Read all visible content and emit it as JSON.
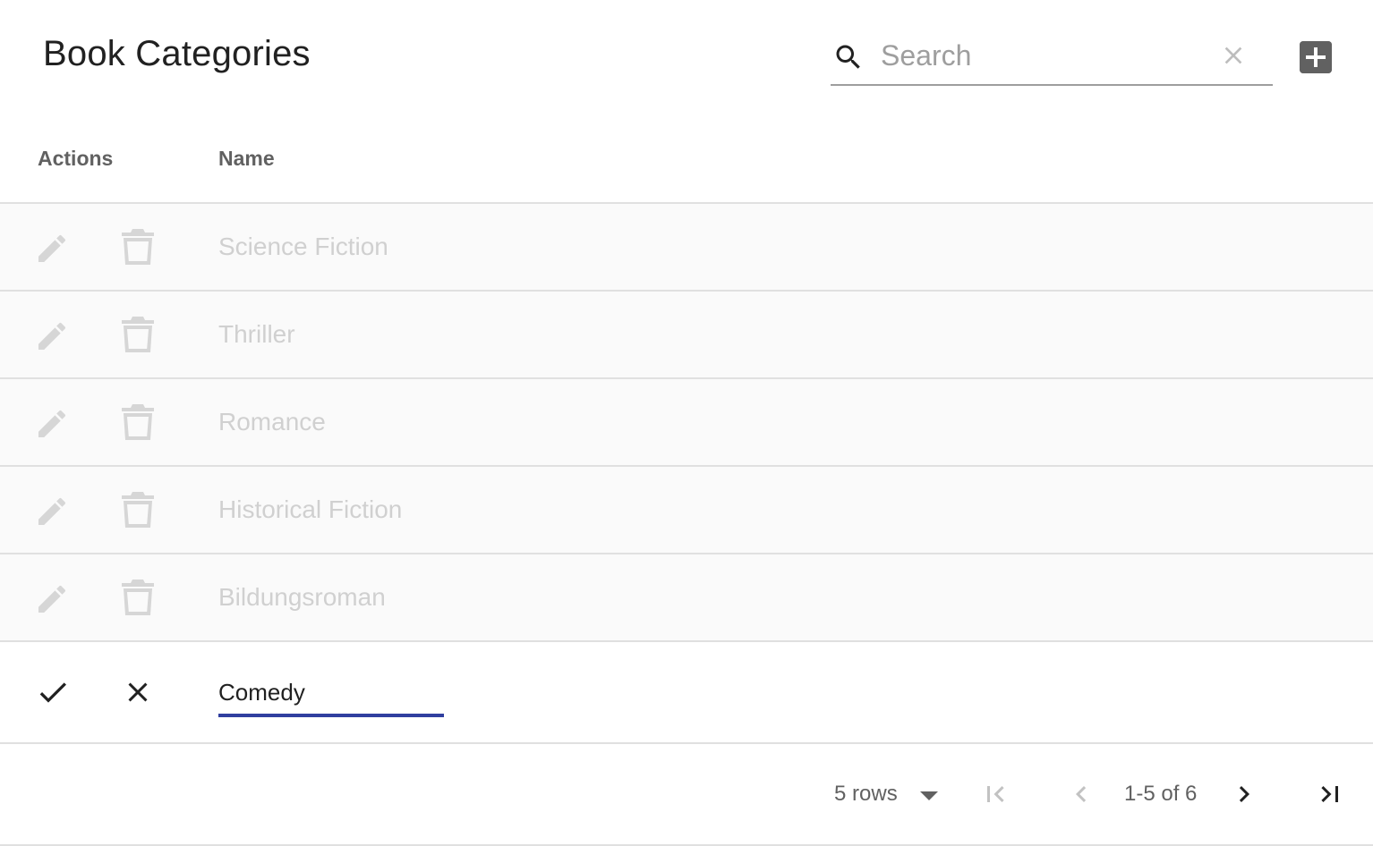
{
  "header": {
    "title": "Book Categories",
    "search": {
      "placeholder": "Search",
      "value": ""
    }
  },
  "table": {
    "columns": {
      "actions": "Actions",
      "name": "Name"
    },
    "rows": [
      {
        "name": "Science Fiction"
      },
      {
        "name": "Thriller"
      },
      {
        "name": "Romance"
      },
      {
        "name": "Historical Fiction"
      },
      {
        "name": "Bildungsroman"
      }
    ],
    "edit_row": {
      "value": "Comedy"
    }
  },
  "pagination": {
    "rows_per_page_label": "5 rows",
    "range_label": "1-5 of 6"
  },
  "colors": {
    "accent": "#303f9f",
    "icon": "#616161",
    "disabled_text": "#d0d0d0",
    "row_bg": "#fafafa"
  },
  "icons": {
    "search": "search-icon",
    "clear": "close-icon",
    "add": "add-box-icon",
    "edit": "pencil-icon",
    "delete": "trash-icon",
    "confirm": "check-icon",
    "cancel": "close-icon",
    "rows_dropdown": "caret-down-icon",
    "first_page": "first-page-icon",
    "prev_page": "chevron-left-icon",
    "next_page": "chevron-right-icon",
    "last_page": "last-page-icon"
  }
}
